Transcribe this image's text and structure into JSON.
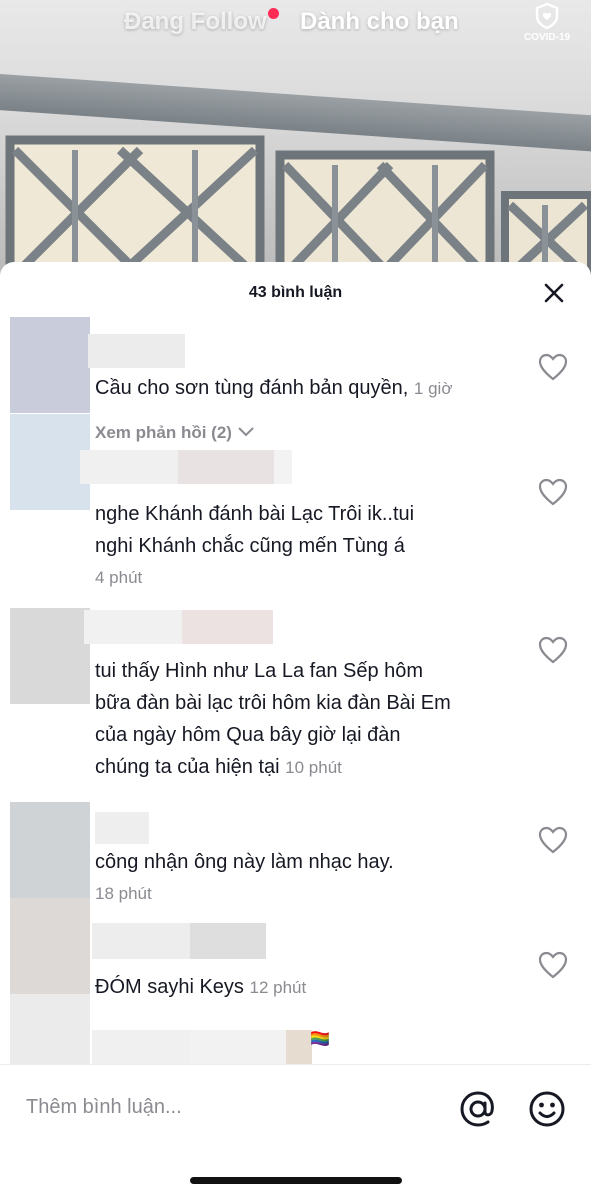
{
  "top_tabs": {
    "following": "Đang Follow",
    "for_you": "Dành cho bạn",
    "covid_label": "COVID-19"
  },
  "sheet": {
    "title": "43 bình luận",
    "close_icon": "close-icon"
  },
  "comments": [
    {
      "avatar_color": "#c9cddb",
      "text": "Cầu cho sơn tùng đánh bản quyền,",
      "time": "1 giờ",
      "reply_label": "Xem phản hồi (2)"
    },
    {
      "avatar_color": "#d7e2ec",
      "text_lines": [
        "nghe Khánh đánh bài Lạc Trôi ik..tui",
        "nghi Khánh chắc cũng mến Tùng á"
      ],
      "time": "4 phút"
    },
    {
      "avatar_color": "#d9d9d9",
      "text_lines": [
        "tui thấy Hình như La La fan Sếp hôm",
        "bữa đàn bài lạc trôi hôm kia đàn Bài Em",
        "của ngày hôm Qua bây giờ lại đàn",
        "chúng ta của hiện tại"
      ],
      "time": "10 phút"
    },
    {
      "avatar_color": "#d0d3d6",
      "text": "công nhận ông này làm nhạc hay.",
      "time": "18 phút"
    },
    {
      "avatar_color": "#dcd9d6",
      "text": "ĐÓM sayhi Keys",
      "time": "12 phút"
    },
    {
      "avatar_color": "#ebebeb",
      "emoji": "🏳️‍🌈"
    }
  ],
  "input": {
    "placeholder": "Thêm bình luận...",
    "mention_icon": "at-sign-icon",
    "emoji_icon": "smiley-icon"
  },
  "colors": {
    "live_dot": "#fe2c55",
    "text_primary": "#161823",
    "text_secondary": "#8a8b91"
  }
}
